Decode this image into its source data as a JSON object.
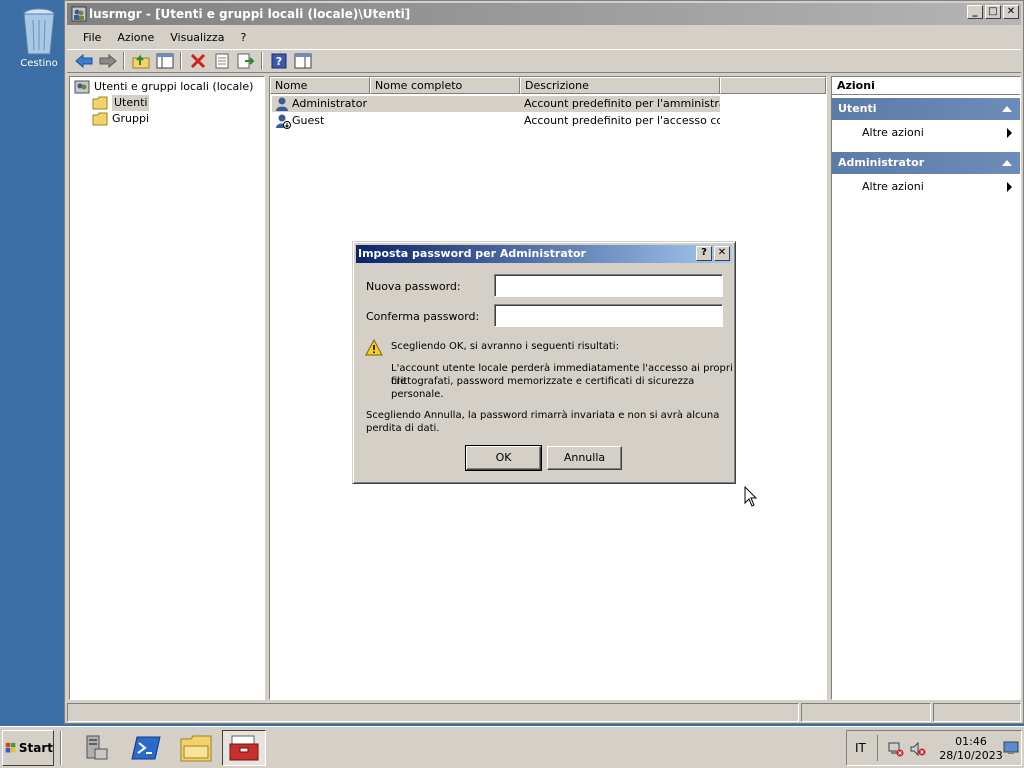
{
  "desktop": {
    "recycle_bin_label": "Cestino"
  },
  "window": {
    "title": "lusrmgr - [Utenti e gruppi locali (locale)\\Utenti]",
    "controls": {
      "minimize": "_",
      "maximize": "□",
      "close": "✕"
    },
    "menu": [
      "File",
      "Azione",
      "Visualizza",
      "?"
    ],
    "toolbar_icons": [
      "back-arrow-icon",
      "forward-arrow-icon",
      "up-folder-icon",
      "show-hide-tree-icon",
      "delete-icon",
      "properties-icon",
      "export-list-icon",
      "help-icon",
      "show-hide-action-pane-icon"
    ]
  },
  "tree": {
    "root": "Utenti e gruppi locali (locale)",
    "children": [
      "Utenti",
      "Gruppi"
    ],
    "selected": "Utenti"
  },
  "list": {
    "columns": [
      "Nome",
      "Nome completo",
      "Descrizione"
    ],
    "rows": [
      {
        "name": "Administrator",
        "full_name": "",
        "description": "Account predefinito per l'amministraz..."
      },
      {
        "name": "Guest",
        "full_name": "",
        "description": "Account predefinito per l'accesso co..."
      }
    ]
  },
  "actions": {
    "title": "Azioni",
    "groups": [
      {
        "name": "Utenti",
        "item": "Altre azioni"
      },
      {
        "name": "Administrator",
        "item": "Altre azioni"
      }
    ]
  },
  "dialog": {
    "title": "Imposta password per Administrator",
    "help_button": "?",
    "close_button": "✕",
    "new_password_label": "Nuova password:",
    "new_password_value": "",
    "confirm_password_label": "Conferma password:",
    "confirm_password_value": "",
    "warning_heading": "Scegliendo OK, si avranno i seguenti risultati:",
    "warning_line1": "L'account utente locale perderà immediatamente l'accesso ai propri file",
    "warning_line2": "crittografati, password memorizzate e certificati di sicurezza personale.",
    "cancel_note_line1": "Scegliendo Annulla, la password rimarrà invariata e non si avrà alcuna",
    "cancel_note_line2": "perdita di dati.",
    "ok_label": "OK",
    "cancel_label": "Annulla"
  },
  "taskbar": {
    "start_label": "Start",
    "pinned": [
      "server-manager-icon",
      "powershell-icon",
      "explorer-folder-icon",
      "lusrmgr-toolbox-icon"
    ],
    "active": "lusrmgr-toolbox-icon",
    "language": "IT",
    "time": "01:46",
    "date": "28/10/2023"
  }
}
